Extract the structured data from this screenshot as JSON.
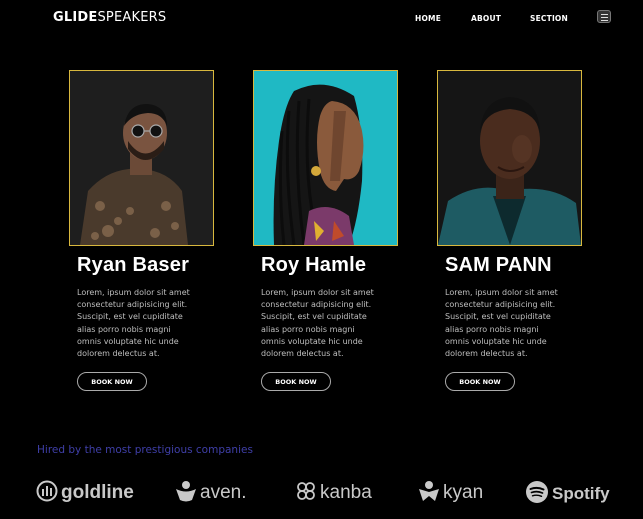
{
  "brand": {
    "bold": "GLIDE",
    "rest": "SPEAKERS"
  },
  "nav": [
    {
      "label": "HOME"
    },
    {
      "label": "ABOUT"
    },
    {
      "label": "SECTION"
    }
  ],
  "speakers": [
    {
      "name": "Ryan Baser",
      "desc": "Lorem, ipsum dolor sit amet consectetur adipisicing elit. Suscipit, est vel cupiditate alias porro nobis magni omnis voluptate hic unde dolorem delectus at.",
      "button": "BOOK NOW"
    },
    {
      "name": "Roy Hamle",
      "desc": "Lorem, ipsum dolor sit amet consectetur adipisicing elit. Suscipit, est vel cupiditate alias porro nobis magni omnis voluptate hic unde dolorem delectus at.",
      "button": "BOOK NOW"
    },
    {
      "name": "SAM PANN",
      "desc": "Lorem, ipsum dolor sit amet consectetur adipisicing elit. Suscipit, est vel cupiditate alias porro nobis magni omnis voluptate hic unde dolorem delectus at.",
      "button": "BOOK NOW"
    }
  ],
  "companies": {
    "title": "Hired by the most prestigious companies",
    "logos": [
      {
        "name": "goldline",
        "icon": "goldline-icon"
      },
      {
        "name": "aven.",
        "icon": "aven-icon"
      },
      {
        "name": "kanba",
        "icon": "kanba-icon"
      },
      {
        "name": "kyan",
        "icon": "kyan-icon"
      },
      {
        "name": "Spotify",
        "icon": "spotify-icon"
      }
    ]
  },
  "colors": {
    "background": "#000000",
    "card_border": "#d8b83e",
    "hired_text": "#3f3fa8",
    "logo": "#c9c9c9"
  }
}
